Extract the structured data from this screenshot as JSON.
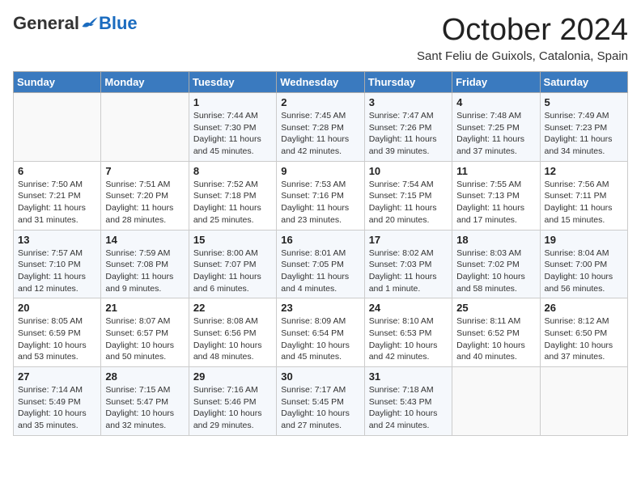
{
  "header": {
    "logo_general": "General",
    "logo_blue": "Blue",
    "month_title": "October 2024",
    "subtitle": "Sant Feliu de Guixols, Catalonia, Spain"
  },
  "days_of_week": [
    "Sunday",
    "Monday",
    "Tuesday",
    "Wednesday",
    "Thursday",
    "Friday",
    "Saturday"
  ],
  "weeks": [
    [
      {
        "day": "",
        "info": ""
      },
      {
        "day": "",
        "info": ""
      },
      {
        "day": "1",
        "info": "Sunrise: 7:44 AM\nSunset: 7:30 PM\nDaylight: 11 hours and 45 minutes."
      },
      {
        "day": "2",
        "info": "Sunrise: 7:45 AM\nSunset: 7:28 PM\nDaylight: 11 hours and 42 minutes."
      },
      {
        "day": "3",
        "info": "Sunrise: 7:47 AM\nSunset: 7:26 PM\nDaylight: 11 hours and 39 minutes."
      },
      {
        "day": "4",
        "info": "Sunrise: 7:48 AM\nSunset: 7:25 PM\nDaylight: 11 hours and 37 minutes."
      },
      {
        "day": "5",
        "info": "Sunrise: 7:49 AM\nSunset: 7:23 PM\nDaylight: 11 hours and 34 minutes."
      }
    ],
    [
      {
        "day": "6",
        "info": "Sunrise: 7:50 AM\nSunset: 7:21 PM\nDaylight: 11 hours and 31 minutes."
      },
      {
        "day": "7",
        "info": "Sunrise: 7:51 AM\nSunset: 7:20 PM\nDaylight: 11 hours and 28 minutes."
      },
      {
        "day": "8",
        "info": "Sunrise: 7:52 AM\nSunset: 7:18 PM\nDaylight: 11 hours and 25 minutes."
      },
      {
        "day": "9",
        "info": "Sunrise: 7:53 AM\nSunset: 7:16 PM\nDaylight: 11 hours and 23 minutes."
      },
      {
        "day": "10",
        "info": "Sunrise: 7:54 AM\nSunset: 7:15 PM\nDaylight: 11 hours and 20 minutes."
      },
      {
        "day": "11",
        "info": "Sunrise: 7:55 AM\nSunset: 7:13 PM\nDaylight: 11 hours and 17 minutes."
      },
      {
        "day": "12",
        "info": "Sunrise: 7:56 AM\nSunset: 7:11 PM\nDaylight: 11 hours and 15 minutes."
      }
    ],
    [
      {
        "day": "13",
        "info": "Sunrise: 7:57 AM\nSunset: 7:10 PM\nDaylight: 11 hours and 12 minutes."
      },
      {
        "day": "14",
        "info": "Sunrise: 7:59 AM\nSunset: 7:08 PM\nDaylight: 11 hours and 9 minutes."
      },
      {
        "day": "15",
        "info": "Sunrise: 8:00 AM\nSunset: 7:07 PM\nDaylight: 11 hours and 6 minutes."
      },
      {
        "day": "16",
        "info": "Sunrise: 8:01 AM\nSunset: 7:05 PM\nDaylight: 11 hours and 4 minutes."
      },
      {
        "day": "17",
        "info": "Sunrise: 8:02 AM\nSunset: 7:03 PM\nDaylight: 11 hours and 1 minute."
      },
      {
        "day": "18",
        "info": "Sunrise: 8:03 AM\nSunset: 7:02 PM\nDaylight: 10 hours and 58 minutes."
      },
      {
        "day": "19",
        "info": "Sunrise: 8:04 AM\nSunset: 7:00 PM\nDaylight: 10 hours and 56 minutes."
      }
    ],
    [
      {
        "day": "20",
        "info": "Sunrise: 8:05 AM\nSunset: 6:59 PM\nDaylight: 10 hours and 53 minutes."
      },
      {
        "day": "21",
        "info": "Sunrise: 8:07 AM\nSunset: 6:57 PM\nDaylight: 10 hours and 50 minutes."
      },
      {
        "day": "22",
        "info": "Sunrise: 8:08 AM\nSunset: 6:56 PM\nDaylight: 10 hours and 48 minutes."
      },
      {
        "day": "23",
        "info": "Sunrise: 8:09 AM\nSunset: 6:54 PM\nDaylight: 10 hours and 45 minutes."
      },
      {
        "day": "24",
        "info": "Sunrise: 8:10 AM\nSunset: 6:53 PM\nDaylight: 10 hours and 42 minutes."
      },
      {
        "day": "25",
        "info": "Sunrise: 8:11 AM\nSunset: 6:52 PM\nDaylight: 10 hours and 40 minutes."
      },
      {
        "day": "26",
        "info": "Sunrise: 8:12 AM\nSunset: 6:50 PM\nDaylight: 10 hours and 37 minutes."
      }
    ],
    [
      {
        "day": "27",
        "info": "Sunrise: 7:14 AM\nSunset: 5:49 PM\nDaylight: 10 hours and 35 minutes."
      },
      {
        "day": "28",
        "info": "Sunrise: 7:15 AM\nSunset: 5:47 PM\nDaylight: 10 hours and 32 minutes."
      },
      {
        "day": "29",
        "info": "Sunrise: 7:16 AM\nSunset: 5:46 PM\nDaylight: 10 hours and 29 minutes."
      },
      {
        "day": "30",
        "info": "Sunrise: 7:17 AM\nSunset: 5:45 PM\nDaylight: 10 hours and 27 minutes."
      },
      {
        "day": "31",
        "info": "Sunrise: 7:18 AM\nSunset: 5:43 PM\nDaylight: 10 hours and 24 minutes."
      },
      {
        "day": "",
        "info": ""
      },
      {
        "day": "",
        "info": ""
      }
    ]
  ]
}
